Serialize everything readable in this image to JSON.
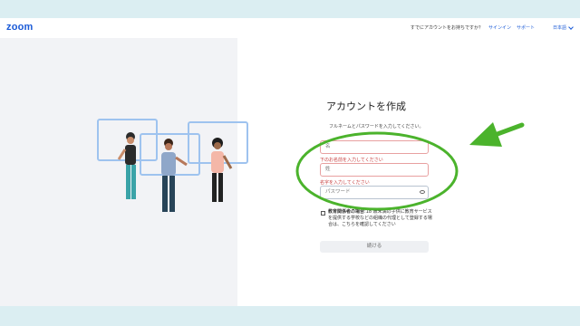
{
  "header": {
    "logo": "zoom",
    "question": "すでにアカウントをお持ちですか？",
    "signin": "サインイン",
    "support": "サポート",
    "language": "日本語"
  },
  "form": {
    "title": "アカウントを作成",
    "subtitle": "フルネームとパスワードを入力してください。",
    "first_name_placeholder": "名",
    "first_name_error": "下のお名前を入力してください",
    "last_name_placeholder": "姓",
    "last_name_error": "名字を入力してください",
    "password_placeholder": "パスワード",
    "consent_bold": "教育関係者の場合",
    "consent_text": ":18 歳未満の子供に教育サービスを提供する学校などの組織の代理として登録する場合は、こちらを確認してください",
    "continue_label": "続ける"
  },
  "colors": {
    "brand": "#1a5ad7",
    "error": "#c53a3a",
    "annotation": "#4bb32c",
    "illustration_frame": "#9ec3ef"
  },
  "annotation": {
    "shapes": [
      "ellipse",
      "arrow"
    ]
  }
}
